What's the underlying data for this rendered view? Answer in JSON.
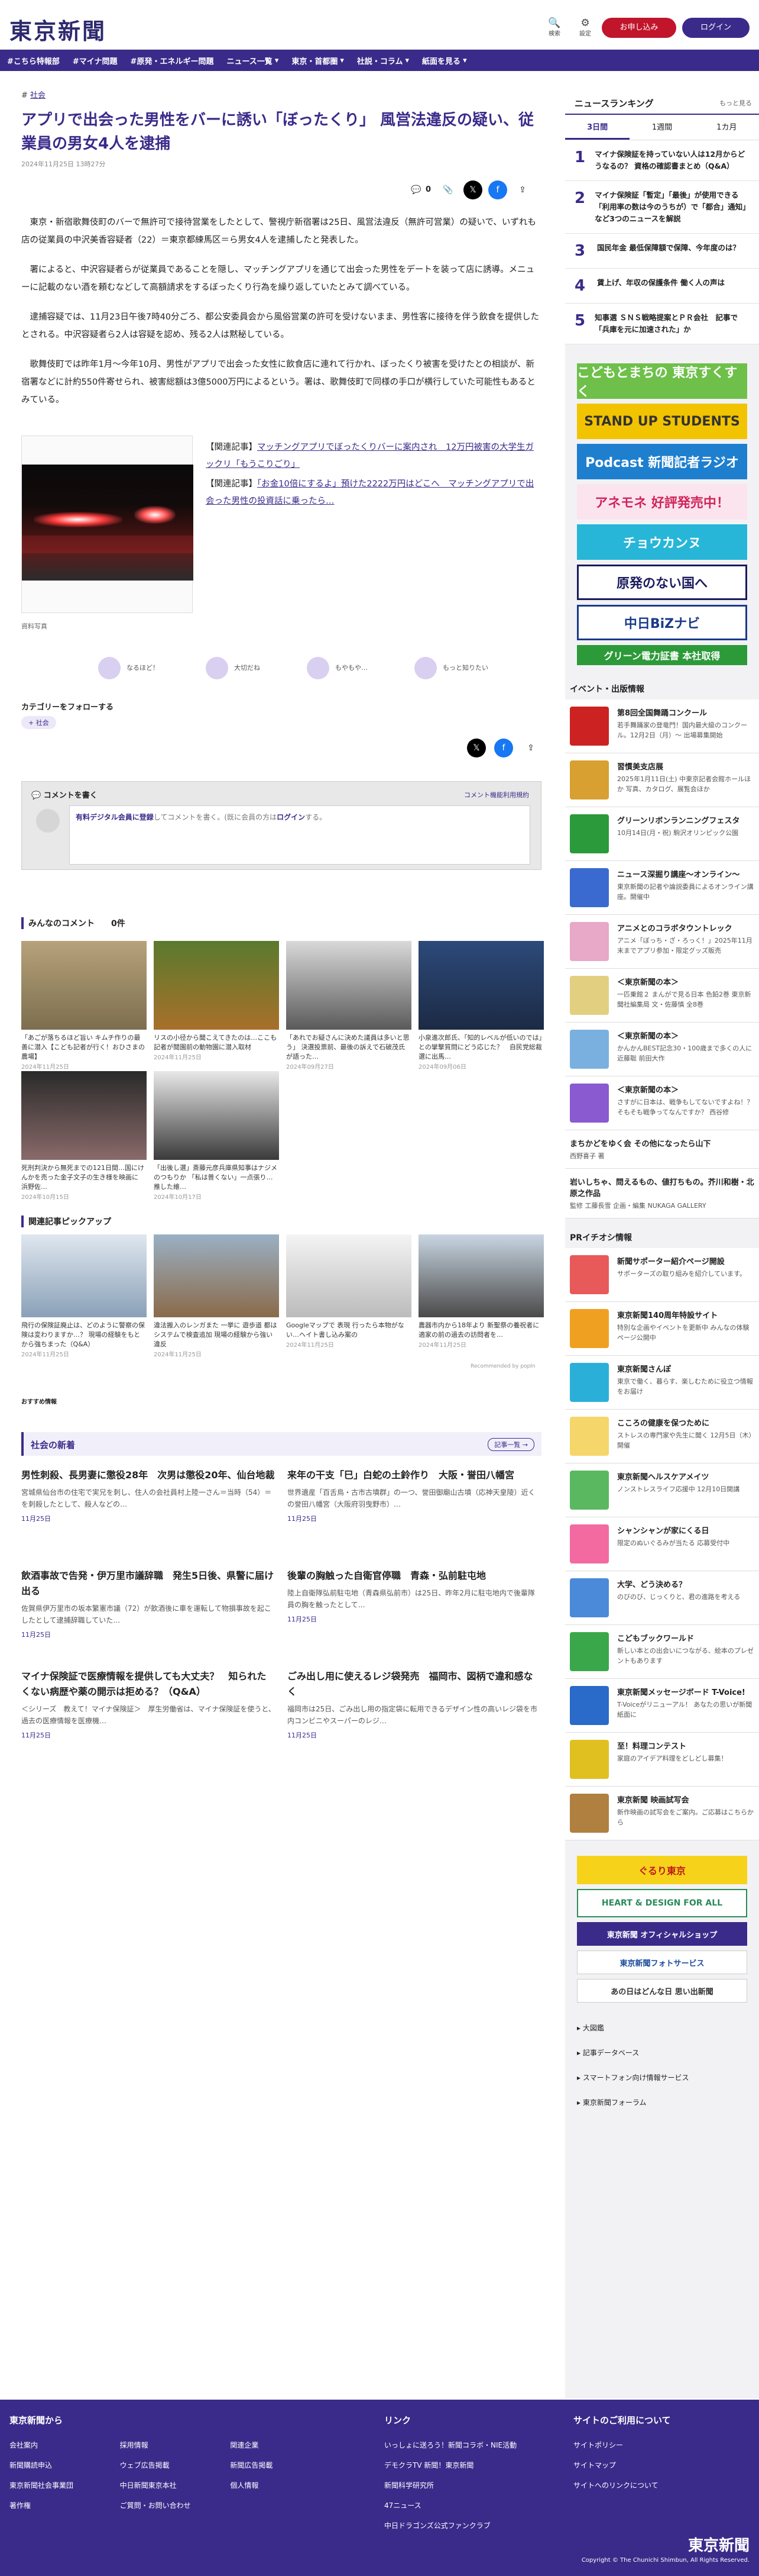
{
  "header": {
    "logo": "東京新聞",
    "search": "検索",
    "settings": "設定",
    "signup": "お申し込み",
    "login": "ログイン"
  },
  "nav": [
    "#こちら特報部",
    "#マイナ問題",
    "#原発・エネルギー問題",
    "ニュース一覧",
    "東京・首都圏",
    "社説・コラム",
    "紙面を見る"
  ],
  "article": {
    "crumb": "社会",
    "title": "アプリで出会った男性をバーに誘い「ぼったくり」 風営法違反の疑い、従業員の男女4人を逮捕",
    "date": "2024年11月25日 13時27分",
    "clip_count": "0",
    "paras": [
      "東京・新宿歌舞伎町のバーで無許可で接待営業をしたとして、警視庁新宿署は25日、風営法違反（無許可営業）の疑いで、いずれも店の従業員の中沢美香容疑者（22）＝東京都練馬区＝ら男女4人を逮捕したと発表した。",
      "署によると、中沢容疑者らが従業員であることを隠し、マッチングアプリを通じて出会った男性をデートを装って店に誘導。メニューに記載のない酒を頼むなどして高額請求をするぼったくり行為を繰り返していたとみて調べている。",
      "逮捕容疑では、11月23日午後7時40分ごろ、都公安委員会から風俗営業の許可を受けないまま、男性客に接待を伴う飲食を提供したとされる。中沢容疑者ら2人は容疑を認め、残る2人は黙秘している。",
      "歌舞伎町では昨年1月～今年10月、男性がアプリで出会った女性に飲食店に連れて行かれ、ぼったくり被害を受けたとの相談が、新宿署などに計約550件寄せられ、被害総額は3億5000万円によるという。署は、歌舞伎町で同様の手口が横行していた可能性もあるとみている。"
    ],
    "photo_caption": "資料写真",
    "related_label": "【関連記事】",
    "related": [
      "マッチングアプリでぼったくりバーに案内され　12万円被害の大学生ガックリ「もうこりごり」",
      "「お金10倍にするよ」預けた2222万円はどこへ　マッチングアプリで出会った男性の投資話に乗ったら…"
    ]
  },
  "reactions": [
    "なるほど！",
    "大切だね",
    "もやもや…",
    "もっと知りたい"
  ],
  "follow": {
    "label": "カテゴリーをフォローする",
    "tag": "社会"
  },
  "comment": {
    "title": "コメントを書く",
    "guide": "コメント機能利用規約",
    "prompt_link": "有料デジタル会員に登録",
    "prompt_mid": "してコメントを書く。(既に会員の方は",
    "prompt_login": "ログイン",
    "prompt_end": "する。"
  },
  "everyone": {
    "label": "みんなのコメント",
    "count": "0件"
  },
  "popular": [
    {
      "text": "「あごが落ちるほど旨い キムチ作りの最善に潜入【こども記者が行く！おひさまの農場】",
      "date": "2024年11月25日"
    },
    {
      "text": "リスの小径から聞こえてきたのは…ここも記者が閲園前の動物園に潜入取材",
      "date": "2024年11月25日"
    },
    {
      "text": "「あれでお疑さんに決めた議員は多いと思う」 決選投票前、最後の訴えで石破茂氏が語った…",
      "date": "2024年09月27日"
    },
    {
      "text": "小泉進次郎氏、「知的レベルが低いのでは」との攣撃質問にどう応じた？　自民党総裁選に出馬…",
      "date": "2024年09月06日"
    },
    {
      "text": "死刑判決から無死までの121日間…国にけんかを売った金子文子の生き様を映画に　浜野佐…",
      "date": "2024年10月15日"
    },
    {
      "text": "「出後し選」斎藤元彦兵庫県知事はナジメのつもりか 「私は普くない」一点張り…推した維…",
      "date": "2024年10月17日"
    }
  ],
  "related_pickup": {
    "label": "関連記事ピックアップ",
    "items": [
      {
        "text": "飛行の保険証廃止は、どのように警察の保険は変わりますか…？ 現場の経験をもとから強ちまった（Q&A）",
        "date": "2024年11月25日"
      },
      {
        "text": "違法搬入のレンガまた 一挙に 遊歩道 都はシステムで検査追加 現場の経験から強い違反",
        "date": "2024年11月25日"
      },
      {
        "text": "Googleマップで 表現 行ったら本物がない…ヘイト書し込み案の",
        "date": "2024年11月25日"
      },
      {
        "text": "農器市内から18年より 新聖祭の養祝者に適家の前の過去の訪問者を…",
        "date": "2024年11月25日"
      }
    ],
    "recommend": "おすすめ情報",
    "ad": "Recommended by popIn"
  },
  "news": {
    "label": "社会の新着",
    "more": "記事一覧",
    "items": [
      {
        "title": "男性刺殺、長男妻に懲役28年　次男は懲役20年、仙台地裁",
        "desc": "宮城県仙台市の住宅で実兄を刺し、住人の会社員村上陸一さん＝当時（54）＝を刺殺したとして、殺人などの…",
        "date": "11月25日"
      },
      {
        "title": "来年の干支「巳」白蛇の土鈴作り　大阪・誉田八幡宮",
        "desc": "世界遺産「百舌鳥・古市古墳群」の一つ、誉田御廟山古墳（応神天皇陵）近くの誉田八幡宮（大阪府羽曳野市）…",
        "date": "11月25日"
      },
      {
        "title": "飲酒事故で告発・伊万里市議辞職　発生5日後、県警に届け出る",
        "desc": "佐賀県伊万里市の坂本繁憲市議（72）が飲酒後に車を運転して物損事故を起こしたとして逮捕辞職していた…",
        "date": "11月25日"
      },
      {
        "title": "後輩の胸触った自衛官停職　青森・弘前駐屯地",
        "desc": "陸上自衛隊弘前駐屯地（青森県弘前市）は25日、昨年2月に駐屯地内で後輩隊員の胸を触ったとして…",
        "date": "11月25日"
      },
      {
        "title": "マイナ保険証で医療情報を提供しても大丈夫？　知られたくない病歴や薬の開示は拒める？（Q&A）",
        "desc": "＜シリーズ　教えて！マイナ保険証＞　厚生労働省は、マイナ保険証を使うと、過去の医療情報を医療機…",
        "date": "11月25日"
      },
      {
        "title": "ごみ出し用に使えるレジ袋発売　福岡市、図柄で違和感なく",
        "desc": "福岡市は25日、ごみ出し用の指定袋に転用できるデザイン性の高いレジ袋を市内コンビニやスーパーのレジ…",
        "date": "11月25日"
      }
    ]
  },
  "ranking": {
    "title": "ニュースランキング",
    "more": "もっと見る",
    "tabs": [
      "3日間",
      "1週間",
      "1カ月"
    ],
    "items": [
      "マイナ保険証を持っていない人は12月からどうなるの？ 資格の確認書まとめ（Q&A）",
      "マイナ保険証「暫定」「最後」が使用できる「利用率の数は今のうちが）で「都合」通知」など3つのニュースを解説",
      "国民年金 最低保障額で保障、今年度のは？",
      "賃上げ、年収の保護条件 働く人の声は",
      "知事選 ＳＮＳ戦略提案とＰＲ会社　記事で「兵庫を元に加速された」か"
    ]
  },
  "banners": [
    "こどもとまちの 東京すくすく",
    "STAND UP STUDENTS",
    "Podcast 新聞記者ラジオ",
    "アネモネ 好評発売中！",
    "チョウカンヌ",
    "原発のない国へ",
    "中日BiZナビ",
    "グリーン電力証書 本社取得"
  ],
  "events": {
    "label": "イベント・出版情報",
    "items": [
      {
        "t": "第8回全国舞踊コンクール",
        "s": "若手舞踊家の登竜門！国内最大級のコンクール。12月2日（月）～ 出場募集開始"
      },
      {
        "t": "習慣美支店展",
        "s": "2025年1月11日(土) 中東京記者会館ホールほか 写真、カタログ、展覧会ほか"
      },
      {
        "t": "グリーンリボンランニングフェスタ",
        "s": "10月14日(月・祝) 駒沢オリンピック公園"
      },
      {
        "t": "ニュース深掘り講座〜オンライン〜",
        "s": "東京新聞の記者や論説委員によるオンライン講座。開催中"
      },
      {
        "t": "アニメとのコラボタウントレック",
        "s": "アニメ「ぼっち・ざ・ろっく！」2025年11月末までアプリ参加・限定グッズ販売"
      },
      {
        "t": "＜東京新聞の本＞",
        "s": "一匹乗館２ まんがで見る日本 色鉛2巻 東京新聞社編集局 文・佐藤慎 全8巻"
      },
      {
        "t": "＜東京新聞の本＞",
        "s": "かんかんBEST記念30・100歳まで多くの人に 近藤聡 前田大作"
      },
      {
        "t": "＜東京新聞の本＞",
        "s": "さすがに日本は、戦争もしてないですよね！？そもそも戦争ってなんですか？ 西谷修"
      },
      {
        "t": "まちかどをゆく会 その他になったら山下",
        "s": "西野喜子 著"
      },
      {
        "t": "岩いしちゃ、問えるもの、値打ちもの。芥川和樹・北原之作品",
        "s": "監修 工藤長雪 企画・編集 NUKAGA GALLERY"
      }
    ]
  },
  "pr": {
    "label": "PRイチオシ情報",
    "items": [
      {
        "t": "新聞サポーター紹介ページ開設",
        "s": "サポーターズの取り組みを紹介しています。"
      },
      {
        "t": "東京新聞140周年特設サイト",
        "s": "特別な企画やイベントを更新中 みんなの体験ページ公開中"
      },
      {
        "t": "東京新聞さんぽ",
        "s": "東京で働く、暮らす、楽しむために役立つ情報をお届け"
      },
      {
        "t": "こころの健康を保つために",
        "s": "ストレスの専門家や先生に聞く 12月5日（木）開催"
      },
      {
        "t": "東京新聞ヘルスケアメイツ",
        "s": "ノンストレスライフ応援中 12月10日開講"
      },
      {
        "t": "シャンシャンが家にくる日",
        "s": "限定のぬいぐるみが当たる 応募受付中"
      },
      {
        "t": "大学、どう決める？",
        "s": "のびのび、じっくりと、君の進路を考える"
      },
      {
        "t": "こどもブックワールド",
        "s": "新しい本との出会いにつながる、絵本のプレゼントもあります"
      },
      {
        "t": "東京新聞メッセージボード T-Voice!",
        "s": "T-Voiceがリニューアル！ あなたの思いが新聞紙面に"
      },
      {
        "t": "至！料理コンテスト",
        "s": "家庭のアイデア料理をどしどし募集！"
      },
      {
        "t": "東京新聞 映画試写会",
        "s": "新作映画の試写会をご案内。ご応募はこちらから"
      }
    ]
  },
  "side_banners": [
    "ぐるり東京",
    "HEART & DESIGN FOR ALL",
    "東京新聞 オフィシャルショップ",
    "東京新聞フォトサービス",
    "あの日はどんな日 思い出新聞"
  ],
  "side_links": [
    "大図鑑",
    "記事データベース",
    "スマートフォン向け情報サービス",
    "東京新聞フォーラム"
  ],
  "footer": {
    "col1": "東京新聞から",
    "col2": "リンク",
    "col3": "サイトのご利用について",
    "c1": [
      "会社案内",
      "新聞購読申込",
      "東京新聞社会事業団",
      "著作権",
      "採用情報",
      "ウェブ広告掲載",
      "中日新聞東京本社",
      "ご質問・お問い合わせ",
      "関連企業",
      "新聞広告掲載",
      "個人情報"
    ],
    "c2": [
      "いっしょに送ろう！新聞コラボ・NIE活動",
      "デモクラTV 新聞！東京新聞",
      "新聞科学研究所",
      "47ニュース",
      "中日ドラゴンズ公式ファンクラブ"
    ],
    "c3": [
      "サイトポリシー",
      "サイトマップ",
      "サイトへのリンクについて"
    ],
    "copyright": "Copyright © The Chunichi Shimbun, All Rights Reserved."
  }
}
